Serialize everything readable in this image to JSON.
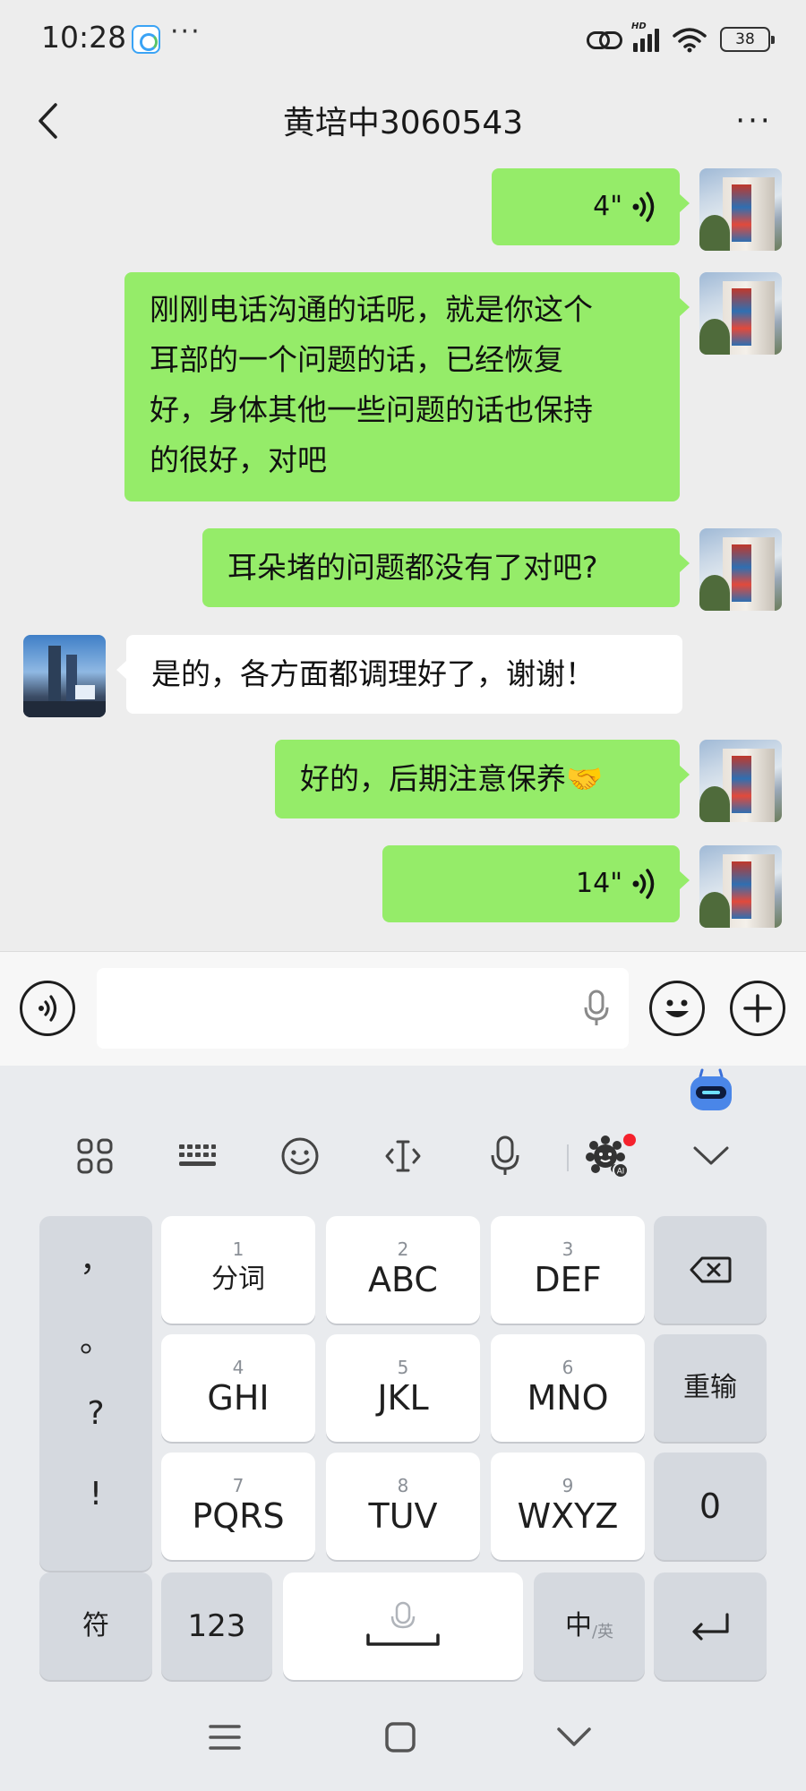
{
  "status_bar": {
    "time": "10:28",
    "more_dots": "···",
    "network_label": "HD",
    "battery": "38"
  },
  "header": {
    "title": "黄培中3060543",
    "more": "···"
  },
  "messages": [
    {
      "side": "me",
      "type": "voice",
      "duration": "4\""
    },
    {
      "side": "me",
      "type": "text",
      "lines": [
        "刚刚电话沟通的话呢，就是你这个",
        "耳部的一个问题的话，已经恢复",
        "好，身体其他一些问题的话也保持",
        "的很好，对吧"
      ]
    },
    {
      "side": "me",
      "type": "text",
      "text": "耳朵堵的问题都没有了对吧?"
    },
    {
      "side": "other",
      "type": "text",
      "text": "是的，各方面都调理好了，谢谢！"
    },
    {
      "side": "me",
      "type": "text",
      "text": "好的，后期注意保养🤝"
    },
    {
      "side": "me",
      "type": "voice",
      "duration": "14\""
    }
  ],
  "input_bar": {
    "value": "",
    "placeholder": ""
  },
  "keyboard": {
    "punctuation": [
      "，",
      "。",
      "?",
      "!"
    ],
    "keys": [
      {
        "num": "1",
        "label": "分词"
      },
      {
        "num": "2",
        "label": "ABC"
      },
      {
        "num": "3",
        "label": "DEF"
      },
      {
        "num": "4",
        "label": "GHI"
      },
      {
        "num": "5",
        "label": "JKL"
      },
      {
        "num": "6",
        "label": "MNO"
      },
      {
        "num": "7",
        "label": "PQRS"
      },
      {
        "num": "8",
        "label": "TUV"
      },
      {
        "num": "9",
        "label": "WXYZ"
      }
    ],
    "reenter": "重输",
    "zero": "0",
    "symbol": "符",
    "numbers": "123",
    "lang_main": "中",
    "lang_sub": "/英",
    "ai_label": "AI"
  },
  "colors": {
    "my_bubble": "#95ec69",
    "other_bubble": "#ffffff",
    "background": "#ededed",
    "notification_dot": "#f5222d"
  }
}
